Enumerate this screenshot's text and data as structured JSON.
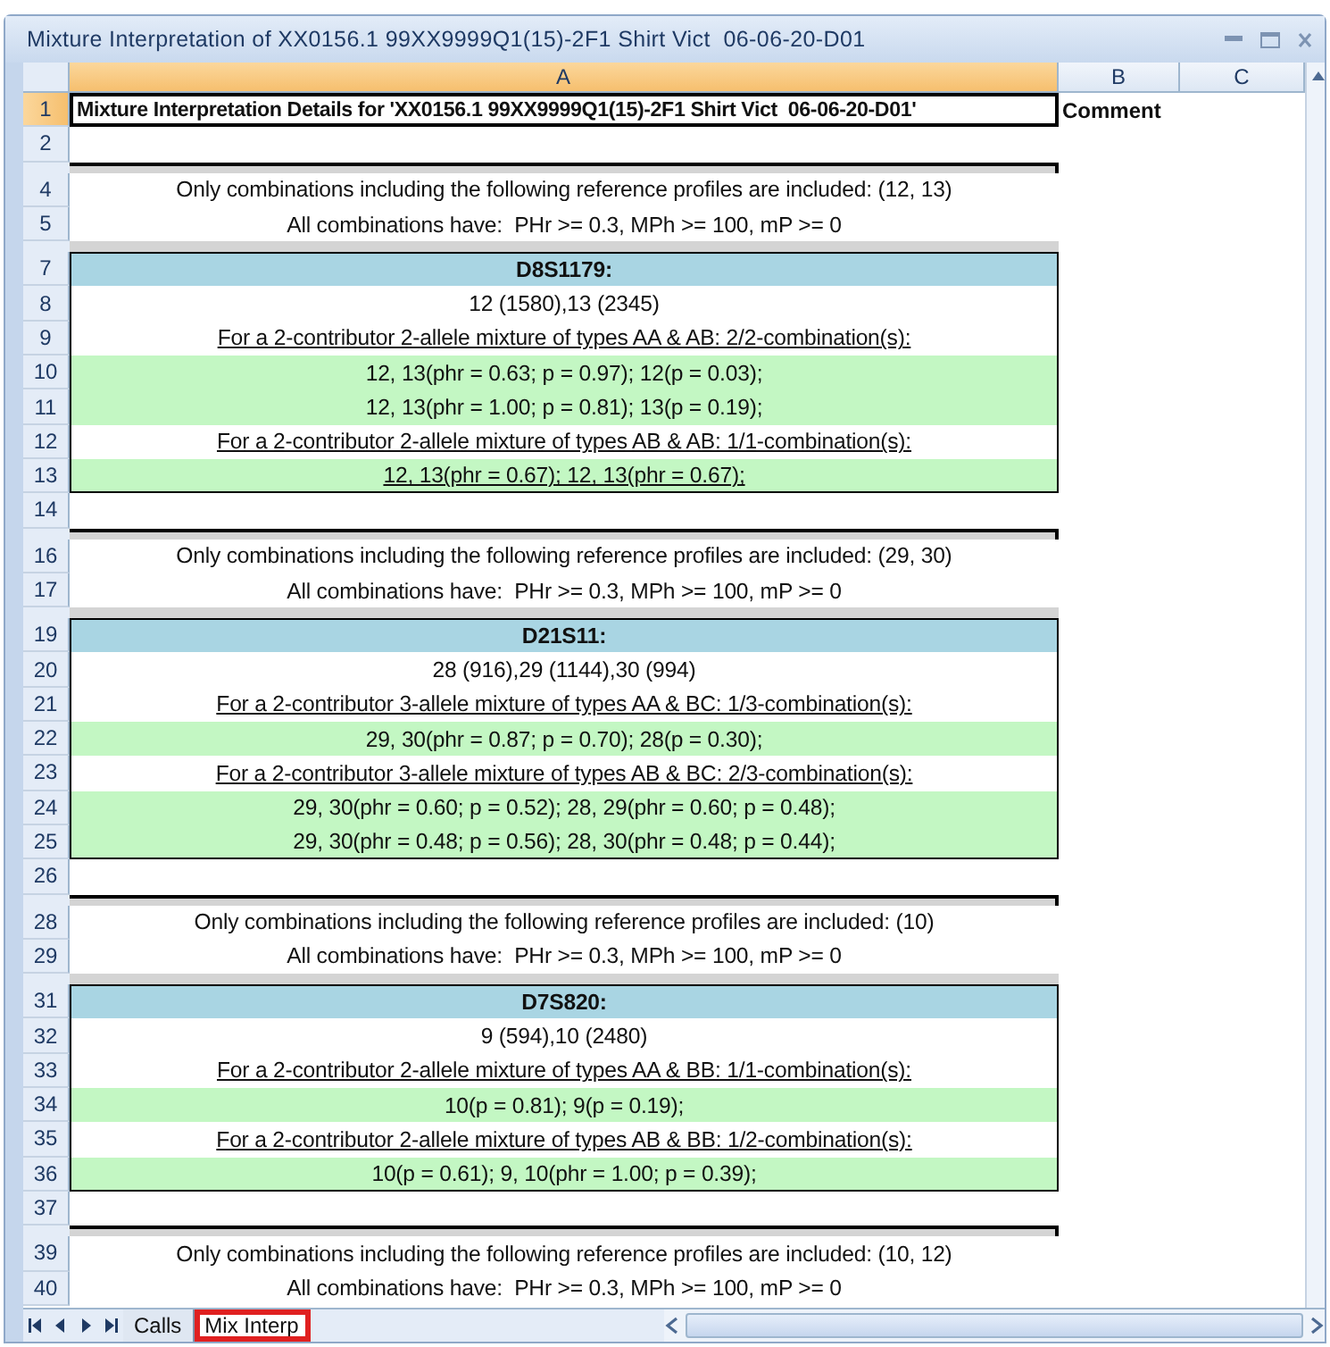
{
  "window": {
    "title": "Mixture Interpretation of XX0156.1 99XX9999Q1(15)-2F1 Shirt Vict  06-06-20-D01"
  },
  "columns": [
    {
      "label": "A",
      "selected": true
    },
    {
      "label": "B",
      "selected": false
    },
    {
      "label": "C",
      "selected": false
    }
  ],
  "rows": [
    {
      "num": "1",
      "kind": "title",
      "selected": true,
      "cells": [
        "Mixture Interpretation Details for 'XX0156.1 99XX9999Q1(15)-2F1 Shirt Vict  06-06-20-D01'",
        "Comment"
      ]
    },
    {
      "num": "2",
      "kind": "blank",
      "selected": false
    },
    {
      "kind": "break"
    },
    {
      "num": "4",
      "kind": "note",
      "selected": false,
      "cells": [
        "Only combinations including the following reference profiles are included: (12, 13)"
      ]
    },
    {
      "num": "5",
      "kind": "note",
      "selected": false,
      "cells": [
        "All combinations have:  PHr >= 0.3, MPh >= 100, mP >= 0"
      ]
    },
    {
      "kind": "gap"
    },
    {
      "num": "7",
      "kind": "locus",
      "selected": false,
      "cells": [
        "D8S1179:"
      ]
    },
    {
      "num": "8",
      "kind": "alleles",
      "selected": false,
      "cells": [
        "12 (1580),13 (2345)"
      ]
    },
    {
      "num": "9",
      "kind": "rule",
      "selected": false,
      "underlined": true,
      "cells": [
        "For a 2-contributor 2-allele mixture of types AA & AB: 2/2-combination(s):"
      ]
    },
    {
      "num": "10",
      "kind": "combo",
      "selected": false,
      "underlined": false,
      "cells": [
        "12, 13(phr = 0.63; p = 0.97); 12(p = 0.03);"
      ]
    },
    {
      "num": "11",
      "kind": "combo",
      "selected": false,
      "underlined": false,
      "cells": [
        "12, 13(phr = 1.00; p = 0.81); 13(p = 0.19);"
      ]
    },
    {
      "num": "12",
      "kind": "rule",
      "selected": false,
      "underlined": true,
      "cells": [
        "For a 2-contributor 2-allele mixture of types AB & AB: 1/1-combination(s):"
      ]
    },
    {
      "num": "13",
      "kind": "combo",
      "selected": false,
      "underlined": true,
      "cells": [
        "12, 13(phr = 0.67); 12, 13(phr = 0.67);"
      ]
    },
    {
      "num": "14",
      "kind": "blank",
      "selected": false
    },
    {
      "kind": "break"
    },
    {
      "num": "16",
      "kind": "note",
      "selected": false,
      "cells": [
        "Only combinations including the following reference profiles are included: (29, 30)"
      ]
    },
    {
      "num": "17",
      "kind": "note",
      "selected": false,
      "cells": [
        "All combinations have:  PHr >= 0.3, MPh >= 100, mP >= 0"
      ]
    },
    {
      "kind": "gap"
    },
    {
      "num": "19",
      "kind": "locus",
      "selected": false,
      "cells": [
        "D21S11:"
      ]
    },
    {
      "num": "20",
      "kind": "alleles",
      "selected": false,
      "cells": [
        "28 (916),29 (1144),30 (994)"
      ]
    },
    {
      "num": "21",
      "kind": "rule",
      "selected": false,
      "underlined": true,
      "cells": [
        "For a 2-contributor 3-allele mixture of types AA & BC: 1/3-combination(s):"
      ]
    },
    {
      "num": "22",
      "kind": "combo",
      "selected": false,
      "underlined": false,
      "cells": [
        "29, 30(phr = 0.87; p = 0.70); 28(p = 0.30);"
      ]
    },
    {
      "num": "23",
      "kind": "rule",
      "selected": false,
      "underlined": true,
      "cells": [
        "For a 2-contributor 3-allele mixture of types AB & BC: 2/3-combination(s):"
      ]
    },
    {
      "num": "24",
      "kind": "combo",
      "selected": false,
      "underlined": false,
      "cells": [
        "29, 30(phr = 0.60; p = 0.52); 28, 29(phr = 0.60; p = 0.48);"
      ]
    },
    {
      "num": "25",
      "kind": "combo",
      "selected": false,
      "underlined": false,
      "cells": [
        "29, 30(phr = 0.48; p = 0.56); 28, 30(phr = 0.48; p = 0.44);"
      ]
    },
    {
      "num": "26",
      "kind": "blank",
      "selected": false
    },
    {
      "kind": "break"
    },
    {
      "num": "28",
      "kind": "note",
      "selected": false,
      "cells": [
        "Only combinations including the following reference profiles are included: (10)"
      ]
    },
    {
      "num": "29",
      "kind": "note",
      "selected": false,
      "cells": [
        "All combinations have:  PHr >= 0.3, MPh >= 100, mP >= 0"
      ]
    },
    {
      "kind": "gap"
    },
    {
      "num": "31",
      "kind": "locus",
      "selected": false,
      "cells": [
        "D7S820:"
      ]
    },
    {
      "num": "32",
      "kind": "alleles",
      "selected": false,
      "cells": [
        "9 (594),10 (2480)"
      ]
    },
    {
      "num": "33",
      "kind": "rule",
      "selected": false,
      "underlined": true,
      "cells": [
        "For a 2-contributor 2-allele mixture of types AA & BB: 1/1-combination(s):"
      ]
    },
    {
      "num": "34",
      "kind": "combo",
      "selected": false,
      "underlined": false,
      "cells": [
        "10(p = 0.81); 9(p = 0.19);"
      ]
    },
    {
      "num": "35",
      "kind": "rule",
      "selected": false,
      "underlined": true,
      "cells": [
        "For a 2-contributor 2-allele mixture of types AB & BB: 1/2-combination(s):"
      ]
    },
    {
      "num": "36",
      "kind": "combo",
      "selected": false,
      "underlined": false,
      "cells": [
        "10(p = 0.61); 9, 10(phr = 1.00; p = 0.39);"
      ]
    },
    {
      "num": "37",
      "kind": "blank",
      "selected": false
    },
    {
      "kind": "break"
    },
    {
      "num": "39",
      "kind": "note",
      "selected": false,
      "cells": [
        "Only combinations including the following reference profiles are included: (10, 12)"
      ]
    },
    {
      "num": "40",
      "kind": "note",
      "selected": false,
      "cells": [
        "All combinations have:  PHr >= 0.3, MPh >= 100, mP >= 0"
      ]
    }
  ],
  "sheet_tabs": [
    {
      "label": "Calls",
      "selected": false,
      "highlighted": false
    },
    {
      "label": "Mix Interp",
      "selected": true,
      "highlighted": true
    }
  ]
}
